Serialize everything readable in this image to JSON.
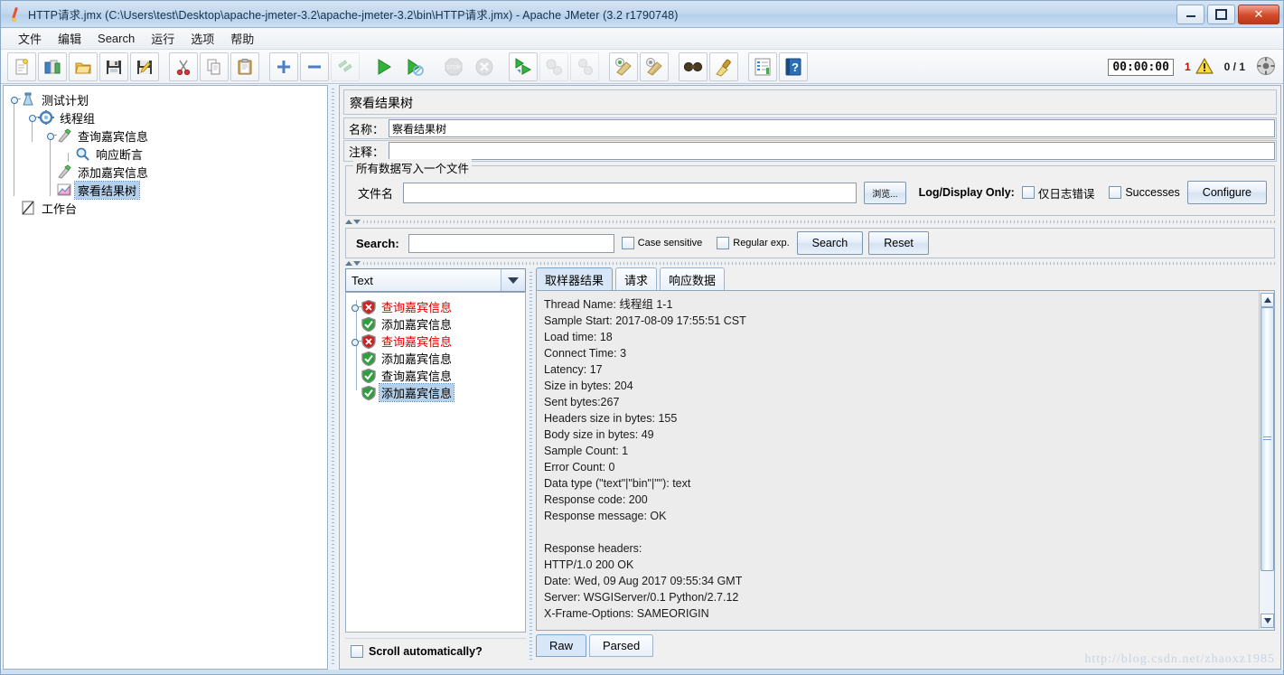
{
  "window": {
    "title": "HTTP请求.jmx (C:\\Users\\test\\Desktop\\apache-jmeter-3.2\\apache-jmeter-3.2\\bin\\HTTP请求.jmx) - Apache JMeter (3.2 r1790748)",
    "icon": "jmeter-feather-icon",
    "buttons": {
      "minimize": "minimize-button",
      "maximize": "maximize-button",
      "close": "close-button"
    }
  },
  "menubar": {
    "items": [
      {
        "label": "文件",
        "name": "menu-file"
      },
      {
        "label": "编辑",
        "name": "menu-edit"
      },
      {
        "label": "Search",
        "name": "menu-search"
      },
      {
        "label": "运行",
        "name": "menu-run"
      },
      {
        "label": "选项",
        "name": "menu-options"
      },
      {
        "label": "帮助",
        "name": "menu-help"
      }
    ]
  },
  "toolbar": {
    "buttons": [
      {
        "name": "new-icon",
        "title": "New"
      },
      {
        "name": "templates-icon",
        "title": "Templates"
      },
      {
        "name": "open-icon",
        "title": "Open"
      },
      {
        "name": "save-icon",
        "title": "Save"
      },
      {
        "name": "save-as-icon",
        "title": "Save As"
      },
      {
        "name": "cut-icon",
        "title": "Cut"
      },
      {
        "name": "copy-icon",
        "title": "Copy"
      },
      {
        "name": "paste-icon",
        "title": "Paste"
      },
      {
        "name": "expand-all-icon",
        "title": "Expand All"
      },
      {
        "name": "collapse-all-icon",
        "title": "Collapse All"
      },
      {
        "name": "toggle-icon",
        "title": "Toggle"
      },
      {
        "name": "start-icon",
        "title": "Start"
      },
      {
        "name": "start-no-pauses-icon",
        "title": "Start no pauses"
      },
      {
        "name": "stop-icon",
        "title": "Stop"
      },
      {
        "name": "shutdown-icon",
        "title": "Shutdown"
      },
      {
        "name": "start-remote-all-icon",
        "title": "Start remote all"
      },
      {
        "name": "stop-remote-all-icon",
        "title": "Stop remote all"
      },
      {
        "name": "shutdown-remote-all-icon",
        "title": "Shutdown remote all"
      },
      {
        "name": "clear-icon",
        "title": "Clear"
      },
      {
        "name": "clear-all-icon",
        "title": "Clear All"
      },
      {
        "name": "search-icon",
        "title": "Search"
      },
      {
        "name": "search-reset-icon",
        "title": "Reset Search"
      },
      {
        "name": "function-helper-icon",
        "title": "Function Helper Dialog"
      },
      {
        "name": "help-icon",
        "title": "Help"
      }
    ],
    "status": {
      "timer": "00:00:00",
      "error_count": "1",
      "warning_icon": "warning-triangle-icon",
      "threads": "0 / 1",
      "gear_icon": "remote-status-icon"
    }
  },
  "tree": {
    "nodes": [
      {
        "label": "测试计划",
        "icon": "test-plan-icon",
        "depth": 0,
        "selected": false
      },
      {
        "label": "线程组",
        "icon": "thread-group-icon",
        "depth": 1,
        "selected": false
      },
      {
        "label": "查询嘉宾信息",
        "icon": "http-sampler-icon",
        "depth": 2,
        "selected": false
      },
      {
        "label": "响应断言",
        "icon": "assertion-icon",
        "depth": 3,
        "selected": false
      },
      {
        "label": "添加嘉宾信息",
        "icon": "http-sampler-icon",
        "depth": 2,
        "selected": false
      },
      {
        "label": "察看结果树",
        "icon": "view-results-tree-icon",
        "depth": 2,
        "selected": true
      },
      {
        "label": "工作台",
        "icon": "workbench-icon",
        "depth": 0,
        "selected": false
      }
    ]
  },
  "panel": {
    "title": "察看结果树",
    "name_label": "名称：",
    "name_value": "察看结果树",
    "comment_label": "注释：",
    "comment_value": "",
    "file_group": {
      "legend": "所有数据写入一个文件",
      "filename_label": "文件名",
      "filename_value": "",
      "browse_label": "浏览...",
      "log_display_only_label": "Log/Display Only:",
      "errors_checkbox_label": "仅日志错误",
      "errors_checked": false,
      "successes_checkbox_label": "Successes",
      "successes_checked": false,
      "configure_label": "Configure"
    },
    "search": {
      "label": "Search:",
      "value": "",
      "case_sensitive_label": "Case sensitive",
      "case_sensitive_checked": false,
      "regular_exp_label": "Regular exp.",
      "regular_exp_checked": false,
      "search_button": "Search",
      "reset_button": "Reset"
    },
    "renderer_combo": {
      "value": "Text",
      "arrow_icon": "chevron-down-icon"
    },
    "scroll_auto_label": "Scroll automatically?",
    "scroll_auto_checked": false,
    "result_tree": [
      {
        "label": "查询嘉宾信息",
        "status": "error",
        "expandable": true,
        "selected": false
      },
      {
        "label": "添加嘉宾信息",
        "status": "success",
        "expandable": false,
        "selected": false
      },
      {
        "label": "查询嘉宾信息",
        "status": "error",
        "expandable": true,
        "selected": false
      },
      {
        "label": "添加嘉宾信息",
        "status": "success",
        "expandable": false,
        "selected": false
      },
      {
        "label": "查询嘉宾信息",
        "status": "success",
        "expandable": false,
        "selected": false
      },
      {
        "label": "添加嘉宾信息",
        "status": "success",
        "expandable": false,
        "selected": true
      }
    ],
    "tabs": [
      {
        "label": "取样器结果",
        "active": true
      },
      {
        "label": "请求",
        "active": false
      },
      {
        "label": "响应数据",
        "active": false
      }
    ],
    "sampler_result_text": "Thread Name: 线程组 1-1\nSample Start: 2017-08-09 17:55:51 CST\nLoad time: 18\nConnect Time: 3\nLatency: 17\nSize in bytes: 204\nSent bytes:267\nHeaders size in bytes: 155\nBody size in bytes: 49\nSample Count: 1\nError Count: 0\nData type (\"text\"|\"bin\"|\"\"): text\nResponse code: 200\nResponse message: OK\n\nResponse headers:\nHTTP/1.0 200 OK\nDate: Wed, 09 Aug 2017 09:55:34 GMT\nServer: WSGIServer/0.1 Python/2.7.12\nX-Frame-Options: SAMEORIGIN",
    "bottom_tabs": [
      {
        "label": "Raw",
        "active": true
      },
      {
        "label": "Parsed",
        "active": false
      }
    ]
  },
  "watermark": "http://blog.csdn.net/zhaoxz1985",
  "colors": {
    "accent": "#3a6ea5",
    "selection": "#b5d0ea",
    "error": "#e00000",
    "success": "#2e9e3e",
    "titlebar": "#c3d8ee"
  }
}
